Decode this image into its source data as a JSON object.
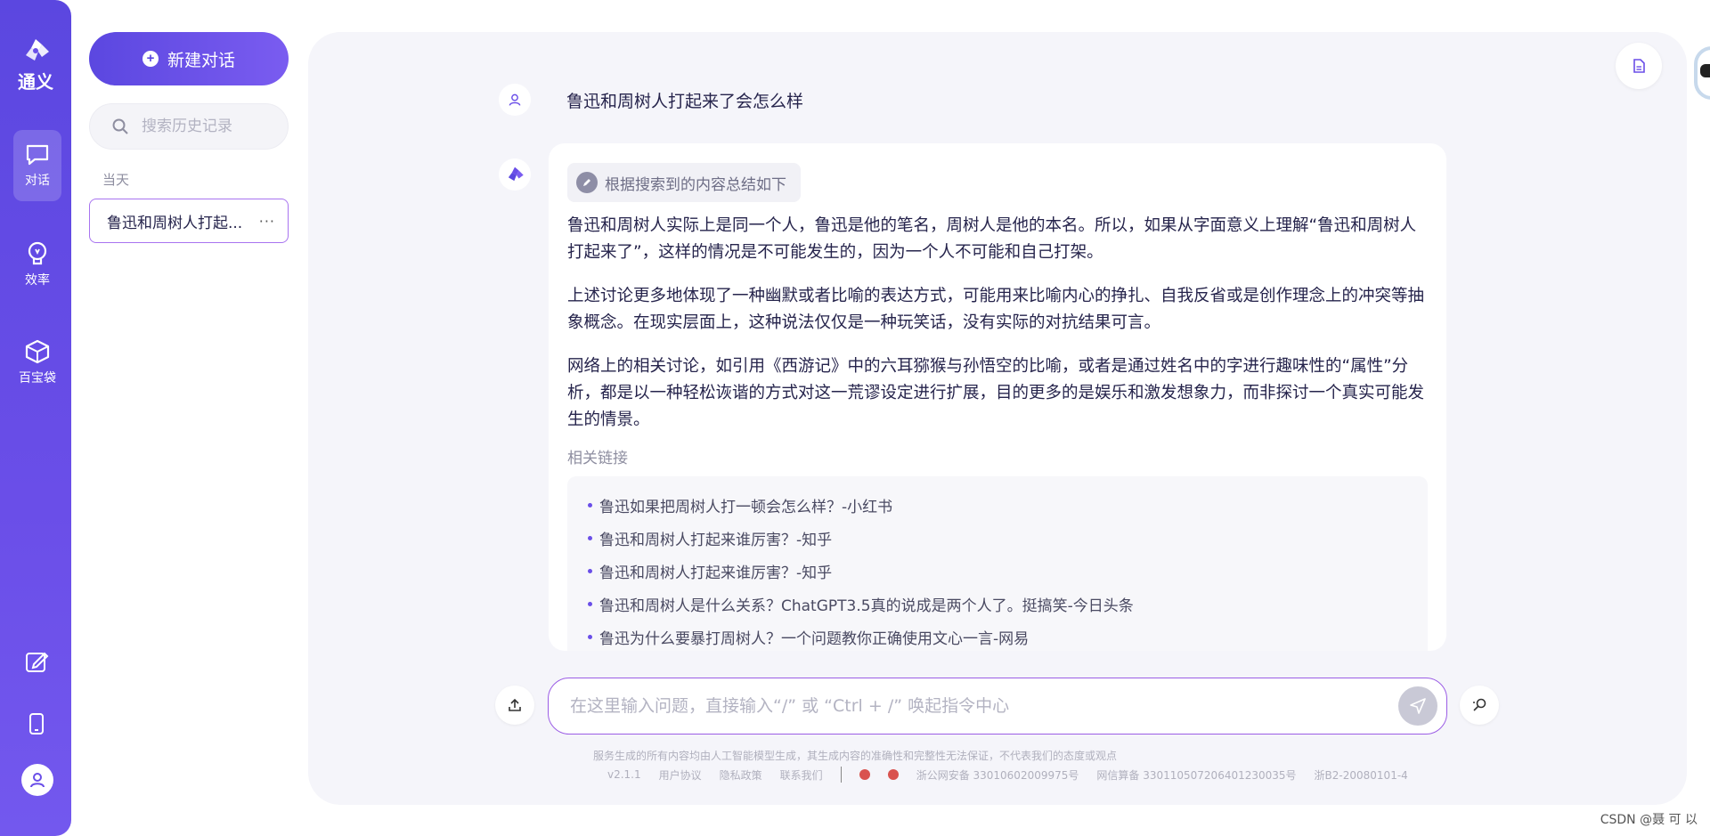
{
  "brand": {
    "name": "通义"
  },
  "rail": {
    "items": [
      {
        "label": "对话",
        "icon": "chat-icon"
      },
      {
        "label": "效率",
        "icon": "bulb-icon"
      },
      {
        "label": "百宝袋",
        "icon": "box-icon"
      }
    ],
    "bottom_icons": [
      "edit-icon",
      "phone-icon",
      "user-icon"
    ]
  },
  "sidebar": {
    "new_chat_label": "新建对话",
    "search_placeholder": "搜索历史记录",
    "section_label": "当天",
    "history": [
      {
        "title": "鲁迅和周树人打起...",
        "more": "···"
      }
    ]
  },
  "conversation": {
    "user_question": "鲁迅和周树人打起来了会怎么样",
    "summary_tag": "根据搜索到的内容总结如下",
    "paragraphs": [
      "鲁迅和周树人实际上是同一个人，鲁迅是他的笔名，周树人是他的本名。所以，如果从字面意义上理解“鲁迅和周树人打起来了”，这样的情况是不可能发生的，因为一个人不可能和自己打架。",
      "上述讨论更多地体现了一种幽默或者比喻的表达方式，可能用来比喻内心的挣扎、自我反省或是创作理念上的冲突等抽象概念。在现实层面上，这种说法仅仅是一种玩笑话，没有实际的对抗结果可言。",
      "网络上的相关讨论，如引用《西游记》中的六耳猕猴与孙悟空的比喻，或者是通过姓名中的字进行趣味性的“属性”分析，都是以一种轻松诙谐的方式对这一荒谬设定进行扩展，目的更多的是娱乐和激发想象力，而非探讨一个真实可能发生的情景。"
    ],
    "related_label": "相关链接",
    "links": [
      "鲁迅如果把周树人打一顿会怎么样？-小红书",
      "鲁迅和周树人打起来谁厉害？-知乎",
      "鲁迅和周树人打起来谁厉害？-知乎",
      "鲁迅和周树人是什么关系？ChatGPT3.5真的说成是两个人了。挺搞笑-今日头条",
      "鲁迅为什么要暴打周树人？一个问题教你正确使用文心一言-网易"
    ]
  },
  "input": {
    "placeholder": "在这里输入问题，直接输入“/” 或 “Ctrl + /” 唤起指令中心"
  },
  "footer": {
    "disclaimer": "服务生成的所有内容均由人工智能模型生成，其生成内容的准确性和完整性无法保证，不代表我们的态度或观点",
    "version": "v2.1.1",
    "links": [
      "用户协议",
      "隐私政策",
      "联系我们"
    ],
    "beian": "浙公网安备 33010602009975号",
    "algo": "网信算备 330110507206401230035号",
    "icp": "浙B2-20080101-4"
  },
  "watermark": "CSDN @聂 可 以",
  "colors": {
    "accent": "#5b47e0",
    "accent_light": "#7a5cf0",
    "border_focus": "#9b5de5",
    "panel_bg": "#f5f5fa"
  }
}
